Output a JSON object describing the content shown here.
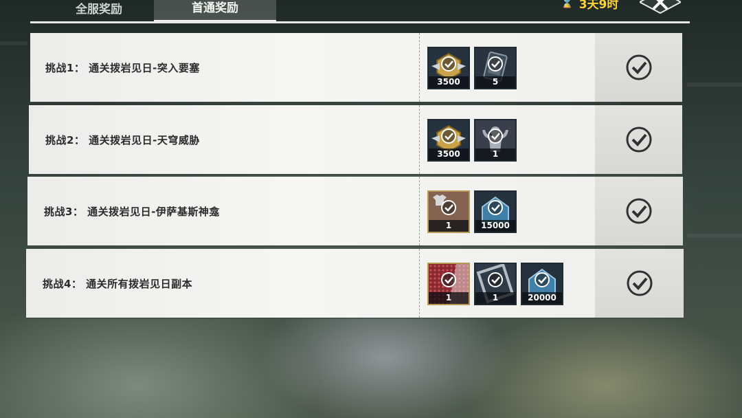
{
  "header": {
    "tabs": [
      {
        "label": "全服奖励",
        "active": false
      },
      {
        "label": "首通奖励",
        "active": true
      }
    ],
    "timer_text": "3天9时",
    "close_icon": "close-x-icon"
  },
  "challenges": [
    {
      "label": "挑战1： 通关拨岩见日-突入要塞",
      "rewards": [
        {
          "icon": "gold-emblem-icon",
          "qty": "3500",
          "claimed": true
        },
        {
          "icon": "card-pack-icon",
          "qty": "5",
          "claimed": true
        }
      ],
      "status": "claimed"
    },
    {
      "label": "挑战2： 通关拨岩见日-天穹威胁",
      "rewards": [
        {
          "icon": "gold-emblem-icon",
          "qty": "3500",
          "claimed": true
        },
        {
          "icon": "strongman-figure-icon",
          "qty": "1",
          "claimed": true
        }
      ],
      "status": "claimed"
    },
    {
      "label": "挑战3： 通关拨岩见日-伊萨基斯神龛",
      "rewards": [
        {
          "icon": "shirt-outfit-icon",
          "qty": "1",
          "claimed": true
        },
        {
          "icon": "blue-house-currency-icon",
          "qty": "15000",
          "claimed": true
        }
      ],
      "status": "claimed"
    },
    {
      "label": "挑战4： 通关所有拨岩见日副本",
      "rewards": [
        {
          "icon": "red-pattern-icon",
          "qty": "1",
          "claimed": true
        },
        {
          "icon": "frame-card-icon",
          "qty": "1",
          "claimed": true
        },
        {
          "icon": "blue-house-currency-icon",
          "qty": "20000",
          "claimed": true
        }
      ],
      "status": "claimed"
    }
  ],
  "colors": {
    "timer": "#ffd23a",
    "row_bg": "#f2f2ef",
    "text_dark": "#2a2c2c"
  }
}
